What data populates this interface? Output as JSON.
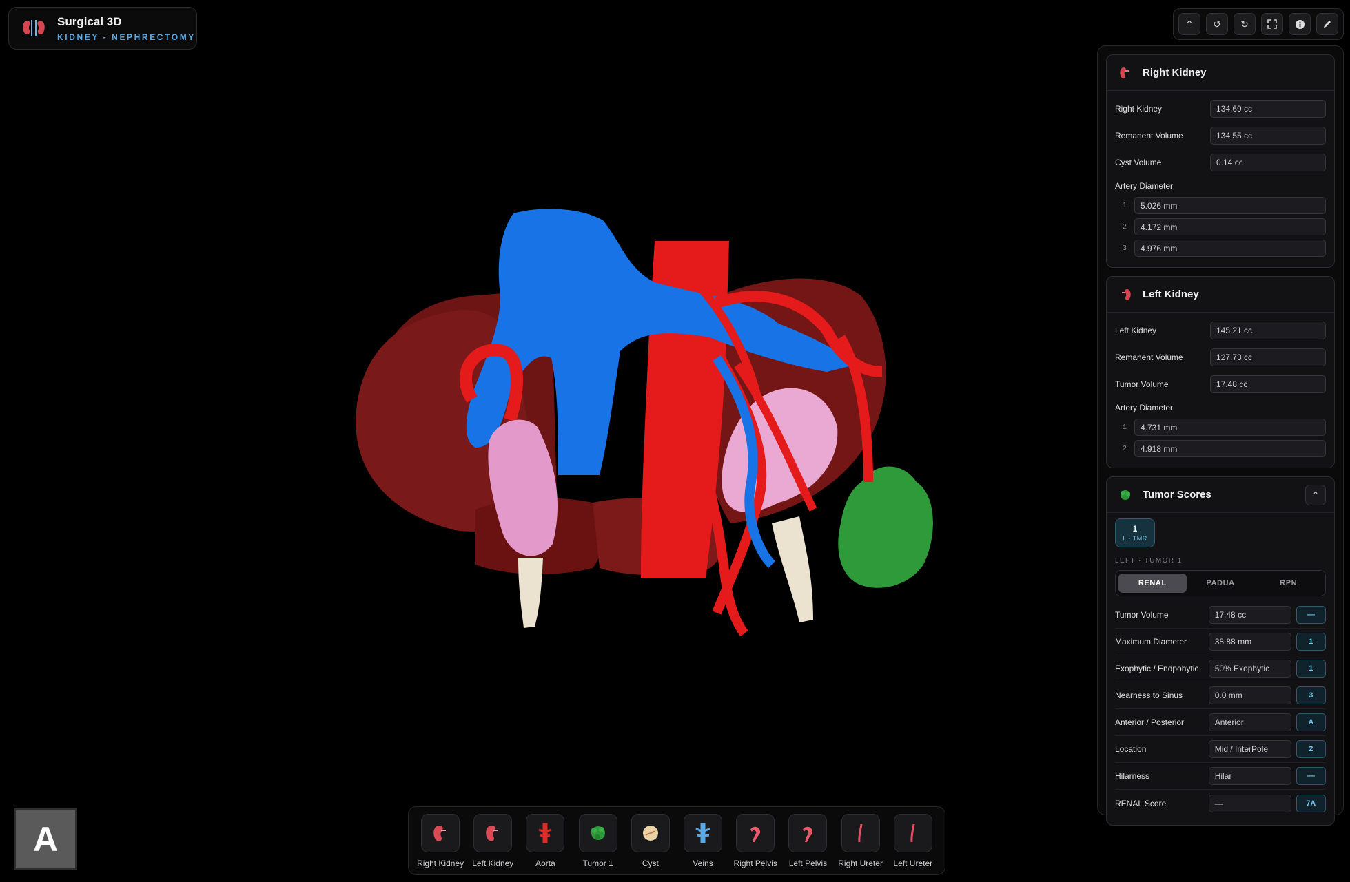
{
  "brand": {
    "title": "Surgical 3D",
    "subtitle": "KIDNEY - NEPHRECTOMY"
  },
  "right_kidney": {
    "title": "Right Kidney",
    "rows": [
      {
        "label": "Right Kidney",
        "value": "134.69 cc"
      },
      {
        "label": "Remanent Volume",
        "value": "134.55 cc"
      },
      {
        "label": "Cyst Volume",
        "value": "0.14 cc"
      }
    ],
    "artery_label": "Artery Diameter",
    "arteries": [
      {
        "n": "1",
        "value": "5.026 mm"
      },
      {
        "n": "2",
        "value": "4.172 mm"
      },
      {
        "n": "3",
        "value": "4.976 mm"
      }
    ]
  },
  "left_kidney": {
    "title": "Left Kidney",
    "rows": [
      {
        "label": "Left Kidney",
        "value": "145.21 cc"
      },
      {
        "label": "Remanent Volume",
        "value": "127.73 cc"
      },
      {
        "label": "Tumor Volume",
        "value": "17.48 cc"
      }
    ],
    "artery_label": "Artery Diameter",
    "arteries": [
      {
        "n": "1",
        "value": "4.731 mm"
      },
      {
        "n": "2",
        "value": "4.918 mm"
      }
    ]
  },
  "tumor_scores": {
    "title": "Tumor Scores",
    "chip_number": "1",
    "chip_label": "L · TMR",
    "subtitle": "LEFT · TUMOR 1",
    "tabs": [
      "RENAL",
      "PADUA",
      "RPN"
    ],
    "active_tab": "RENAL",
    "rows": [
      {
        "label": "Tumor Volume",
        "value": "17.48 cc",
        "score": "—"
      },
      {
        "label": "Maximum Diameter",
        "value": "38.88 mm",
        "score": "1"
      },
      {
        "label": "Exophytic / Endpohytic",
        "value": "50% Exophytic",
        "score": "1"
      },
      {
        "label": "Nearness to Sinus",
        "value": "0.0 mm",
        "score": "3"
      },
      {
        "label": "Anterior / Posterior",
        "value": "Anterior",
        "score": "A"
      },
      {
        "label": "Location",
        "value": "Mid / InterPole",
        "score": "2"
      },
      {
        "label": "Hilarness",
        "value": "Hilar",
        "score": "—"
      },
      {
        "label": "RENAL Score",
        "value": "—",
        "score": "7A"
      }
    ]
  },
  "organs": [
    {
      "name": "Right Kidney",
      "icon": "kidney-icon",
      "color": "#d94a55"
    },
    {
      "name": "Left Kidney",
      "icon": "kidney-icon",
      "color": "#d94a55"
    },
    {
      "name": "Aorta",
      "icon": "aorta-icon",
      "color": "#e02a2a"
    },
    {
      "name": "Tumor 1",
      "icon": "tumor-icon",
      "color": "#2f9a3a"
    },
    {
      "name": "Cyst",
      "icon": "cyst-icon",
      "color": "#e8d2a6"
    },
    {
      "name": "Veins",
      "icon": "veins-icon",
      "color": "#5aa9e6"
    },
    {
      "name": "Right Pelvis",
      "icon": "pelvis-icon",
      "color": "#e65a6a"
    },
    {
      "name": "Left Pelvis",
      "icon": "pelvis-icon",
      "color": "#e65a6a"
    },
    {
      "name": "Right Ureter",
      "icon": "ureter-icon",
      "color": "#e05060"
    },
    {
      "name": "Left Ureter",
      "icon": "ureter-icon",
      "color": "#e05060"
    }
  ],
  "badge": {
    "letter": "A"
  },
  "colors": {
    "accent": "#5aa9e6",
    "kidney": "#7a1a1a",
    "artery": "#e81c1c",
    "vein": "#1a7ae8",
    "tumor": "#2f9a3a",
    "pelvis": "#e6a2c8",
    "ureter": "#ece2d0"
  }
}
